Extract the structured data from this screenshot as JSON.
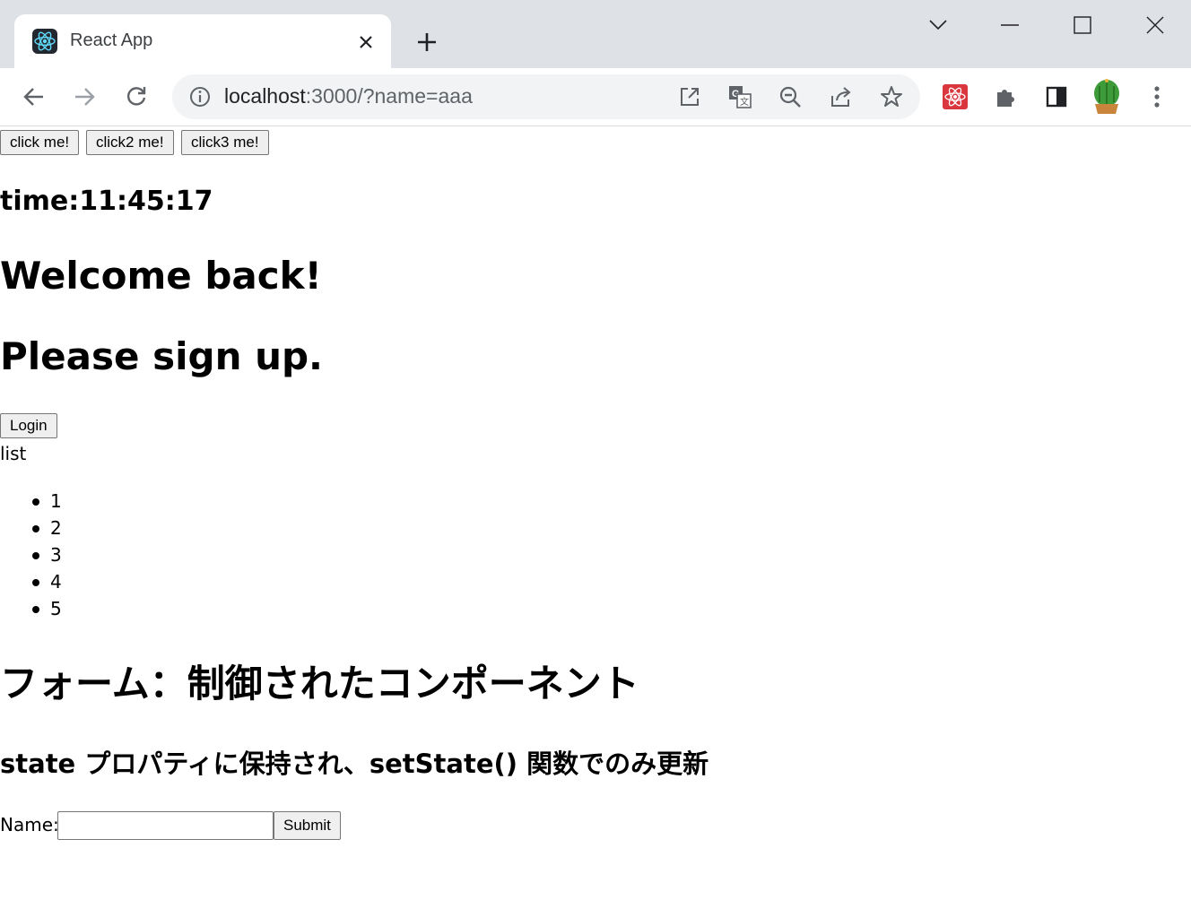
{
  "browser": {
    "tab_title": "React App",
    "url_host": "localhost",
    "url_rest": ":3000/?name=aaa"
  },
  "page": {
    "buttons": [
      "click me!",
      "click2 me!",
      "click3 me!"
    ],
    "time_text": "time:11:45:17",
    "welcome_heading": "Welcome back!",
    "signup_heading": "Please sign up.",
    "login_button": "Login",
    "list_label": "list",
    "list_items": [
      "1",
      "2",
      "3",
      "4",
      "5"
    ],
    "form_heading": "フォーム：制御されたコンポーネント",
    "form_subheading": "state プロパティに保持され、setState() 関数でのみ更新",
    "name_label": "Name:",
    "name_value": "",
    "submit_label": "Submit"
  }
}
